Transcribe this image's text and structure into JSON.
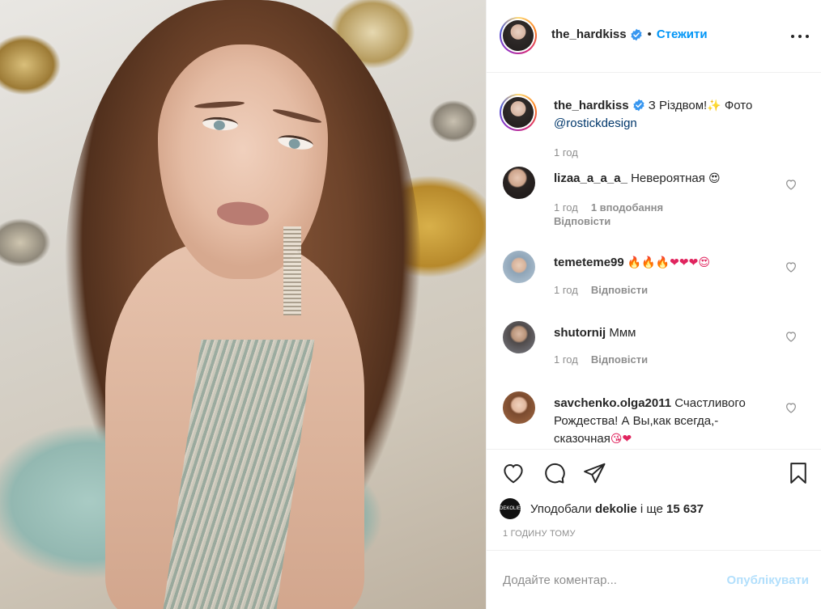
{
  "post": {
    "username": "the_hardkiss",
    "separator": "•",
    "follow_label": "Стежити"
  },
  "caption": {
    "username": "the_hardkiss",
    "text": "З Різдвом!",
    "emoji": "✨",
    "photo_label": "Фото",
    "mention": "@rostickdesign",
    "time": "1 год"
  },
  "comments": [
    {
      "username": "lizaa_a_a_a_",
      "text": "Невероятная",
      "emoji": "😍",
      "time": "1 год",
      "likes": "1 вподобання",
      "reply": "Відповісти"
    },
    {
      "username": "temeteme99",
      "text": "",
      "emoji": "🔥🔥🔥❤❤❤😍",
      "time": "1 год",
      "reply": "Відповісти"
    },
    {
      "username": "shutornij",
      "text": "Ммм",
      "time": "1 год",
      "reply": "Відповісти"
    },
    {
      "username": "savchenko.olga2011",
      "text": "Счастливого Рождества! А Вы,как всегда,-сказочная",
      "emoji": "😘❤"
    }
  ],
  "likes": {
    "prefix": "Уподобали",
    "user": "dekolie",
    "middle": "і ще",
    "count": "15 637",
    "mini_avatar_text": "DEKOLIE"
  },
  "posted_time": "1 ГОДИНУ ТОМУ",
  "add_comment": {
    "placeholder": "Додайте коментар...",
    "publish_label": "Опублікувати"
  },
  "colors": {
    "link_blue": "#0095f6",
    "publish_disabled": "#b2dffc",
    "muted": "#8e8e8e",
    "verified_blue": "#3897f0"
  },
  "icons": [
    "more-options-icon",
    "verified-badge-icon",
    "heart-icon",
    "comment-icon",
    "share-icon",
    "bookmark-icon",
    "comment-like-heart-icon"
  ]
}
